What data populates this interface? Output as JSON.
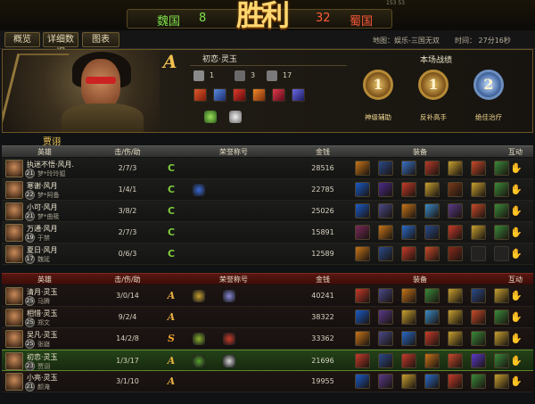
{
  "header": {
    "victory_text": "胜利",
    "top_partial_number": "153 53",
    "teams": [
      {
        "name": "魏国",
        "score": "8",
        "color": "#7fe04a"
      },
      {
        "name": "蜀国",
        "score": "32",
        "color": "#ff5a3a"
      }
    ]
  },
  "tabs": [
    {
      "label": "概览"
    },
    {
      "label": "详细数据"
    },
    {
      "label": "图表"
    }
  ],
  "match_info": {
    "map": "地图：娱乐-三国无双",
    "time": "时间： 27分16秒"
  },
  "player_card": {
    "rank": "A",
    "name": "初恋·灵玉",
    "stats": [
      {
        "icon": "crossed-swords-icon",
        "value": "1"
      },
      {
        "icon": "skull-icon",
        "value": "3"
      },
      {
        "icon": "gear-icon",
        "value": "17"
      }
    ],
    "equipment_icons": [
      "red-rune-icon",
      "blue-shield-icon",
      "red-sword-icon",
      "fire-claw-icon",
      "red-orb-icon",
      "blue-spike-icon"
    ],
    "honor_badges": [
      "green-cloud-badge-icon",
      "white-beast-badge-icon"
    ],
    "battle_record_title": "本场战绩",
    "medals": [
      {
        "symbol": "1",
        "label": "神级辅助",
        "icon": "gold-medal-icon"
      },
      {
        "symbol": "1",
        "label": "反补高手",
        "icon": "gold-medal-icon"
      },
      {
        "symbol": "2",
        "label": "绝佳治疗",
        "icon": "blue-medal-icon"
      }
    ]
  },
  "featured_hero_label": "贾诩",
  "table_headers": {
    "hero": "英雄",
    "kda": "击/伤/助",
    "title": "荣誉称号",
    "gold": "金钱",
    "equip": "装备",
    "interact": "互动"
  },
  "wei_team": [
    {
      "player": "执迷不悟·风月.",
      "hero": "梦*玲玲狐",
      "level": "21",
      "kda": "2/7/3",
      "gold": "28516",
      "titles": [
        "C"
      ],
      "badges": [],
      "equips": [
        "#c8751a",
        "#2a4a8a",
        "#3a72c8",
        "#b83a2a",
        "#c8a030",
        "#c84a2a",
        "#3a8a3a"
      ]
    },
    {
      "player": "寒谢·风月",
      "hero": "梦*阿备",
      "level": "22",
      "kda": "1/4/1",
      "gold": "22785",
      "titles": [
        "C"
      ],
      "badges": [
        "#3a6ad8"
      ],
      "equips": [
        "#1a5ac8",
        "#4a2a8a",
        "#c83a2a",
        "#c8a030",
        "#7a3a1a",
        "#c8a030",
        "#3a8a3a"
      ]
    },
    {
      "player": "小可·风月",
      "hero": "梦*曲筱",
      "level": "21",
      "kda": "3/8/2",
      "gold": "25026",
      "titles": [
        "C"
      ],
      "badges": [],
      "equips": [
        "#1a5ac8",
        "#4a4a8a",
        "#c8751a",
        "#3a8ac8",
        "#5a3a8a",
        "#c84a2a",
        "#3a8a3a"
      ]
    },
    {
      "player": "万通·风月",
      "hero": "于禁",
      "level": "19",
      "kda": "2/7/3",
      "gold": "15891",
      "titles": [
        "C"
      ],
      "badges": [],
      "equips": [
        "#7a2a5a",
        "#c8751a",
        "#2a6ac8",
        "#2a4a8a",
        "#c83a2a",
        "#c8a030",
        "#3a8a3a"
      ]
    },
    {
      "player": "夏日·风月",
      "hero": "魏延",
      "level": "17",
      "kda": "0/6/3",
      "gold": "12589",
      "titles": [
        "C"
      ],
      "badges": [],
      "equips": [
        "#c8751a",
        "#2a4a8a",
        "#c83a2a",
        "#c84a2a",
        "#8a2a1a",
        "",
        ""
      ]
    }
  ],
  "shu_team": [
    {
      "player": "清月·灵玉",
      "hero": "马腾",
      "level": "25",
      "kda": "3/0/14",
      "gold": "40241",
      "titles": [
        "A"
      ],
      "badges": [
        "#c8a030",
        "#8a8ad8"
      ],
      "equips": [
        "#c83a2a",
        "#4a4a8a",
        "#c8751a",
        "#3a8a3a",
        "#c8a030",
        "#2a4a8a",
        "#c8a030"
      ]
    },
    {
      "player": "相惜·灵玉",
      "hero": "郑文",
      "level": "25",
      "kda": "9/2/4",
      "gold": "38322",
      "titles": [
        "A"
      ],
      "badges": [],
      "equips": [
        "#1a5ac8",
        "#5a3a8a",
        "#c8a030",
        "#3a8ac8",
        "#c8a030",
        "#c84a2a",
        "#3a8a3a"
      ]
    },
    {
      "player": "吴凡·灵玉",
      "hero": "张嶷",
      "level": "25",
      "kda": "14/2/8",
      "gold": "33362",
      "titles": [
        "S"
      ],
      "badges": [
        "#8ab030",
        "#c83a2a"
      ],
      "equips": [
        "#c8751a",
        "#4a4a8a",
        "#2a6ac8",
        "#c83a2a",
        "#c8a030",
        "#3a8a3a",
        "#c8a030"
      ]
    },
    {
      "player": "初恋·灵玉",
      "hero": "贾诩",
      "level": "23",
      "kda": "1/3/17",
      "gold": "21696",
      "titles": [
        "A"
      ],
      "badges": [
        "#5aa030",
        "#d8d8d8"
      ],
      "equips": [
        "#c83a2a",
        "#2a4a8a",
        "#c83a2a",
        "#c8751a",
        "#c84a2a",
        "#5a3ac8",
        "#3a8a3a"
      ],
      "me": true
    },
    {
      "player": "小亮·灵玉",
      "hero": "颜淹",
      "level": "21",
      "kda": "3/1/10",
      "gold": "19955",
      "titles": [
        "A"
      ],
      "badges": [],
      "equips": [
        "#1a5ac8",
        "#5a3a8a",
        "#c8a030",
        "#2a6ac8",
        "#c83a2a",
        "#3a8a3a",
        "#c8a030"
      ]
    }
  ],
  "interact_icon": "thumb-up-icon"
}
